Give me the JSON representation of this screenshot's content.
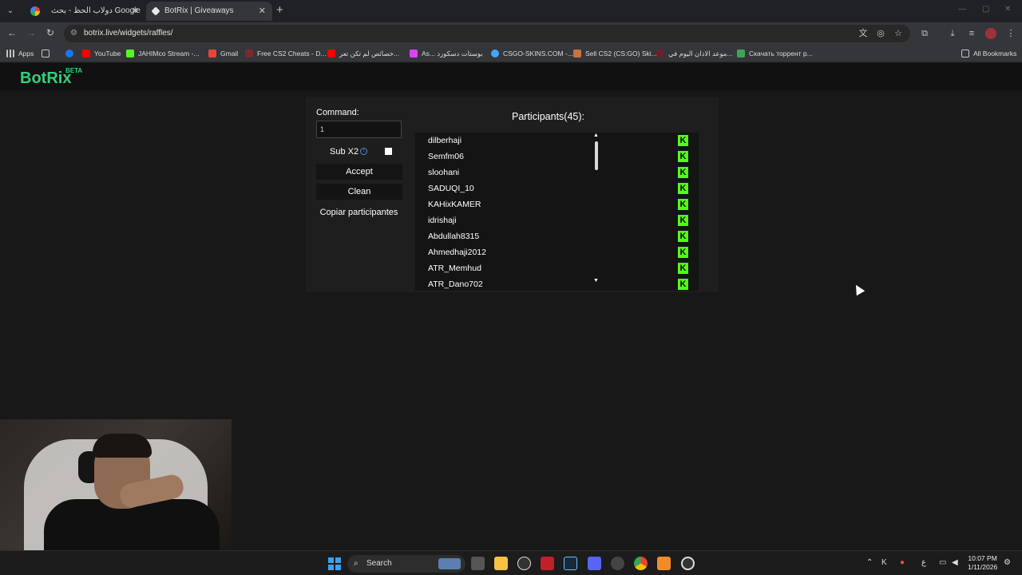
{
  "browser": {
    "tabs": [
      {
        "title": "دولاب الحظ - بحث Google",
        "active": false
      },
      {
        "title": "BotRix | Giveaways",
        "active": true
      }
    ],
    "url": "botrix.live/widgets/raffles/",
    "bookmarks": [
      {
        "label": "Apps",
        "icon": "grid-icon"
      },
      {
        "label": "",
        "icon": "grid-icon"
      },
      {
        "label": "",
        "icon": "facebook-icon"
      },
      {
        "label": "YouTube",
        "icon": "youtube-icon"
      },
      {
        "label": "JAHIMco Stream -...",
        "icon": "kick-icon"
      },
      {
        "label": "Gmail",
        "icon": "gmail-icon"
      },
      {
        "label": "Free CS2 Cheats - D...",
        "icon": "skull-icon"
      },
      {
        "label": "خصائص لم تكن تعر...",
        "icon": "youtube-icon"
      },
      {
        "label": "As... بوستات دسكورد",
        "icon": "gem-icon"
      },
      {
        "label": "CSGO-SKINS.COM -...",
        "icon": "globe-icon"
      },
      {
        "label": "Sell CS2 (CS:GO) Ski...",
        "icon": "skin-icon"
      },
      {
        "label": "موعد الاذان اليوم في...",
        "icon": "mosque-icon"
      },
      {
        "label": "Скачать торрент р...",
        "icon": "torrent-icon"
      }
    ],
    "all_bookmarks_label": "All Bookmarks"
  },
  "app": {
    "logo": "BotRix",
    "beta": "BETA",
    "command_label": "Command:",
    "command_value": "1",
    "sub_label": "Sub X2",
    "sub_checked": false,
    "accept_label": "Accept",
    "clean_label": "Clean",
    "copy_label": "Copiar participantes",
    "participants_title": "Participants(45):",
    "participants": [
      "dilberhaji",
      "Semfm06",
      "sloohani",
      "SADUQI_10",
      "KAHixKAMER",
      "idrishaji",
      "Abdullah8315",
      "Ahmedhaji2012",
      "ATR_Memhud",
      "ATR_Dano702"
    ],
    "platform_badge": "K"
  },
  "taskbar": {
    "search_label": "Search",
    "time": "10:07 PM",
    "date": "1/11/2026",
    "lang": "ع"
  }
}
